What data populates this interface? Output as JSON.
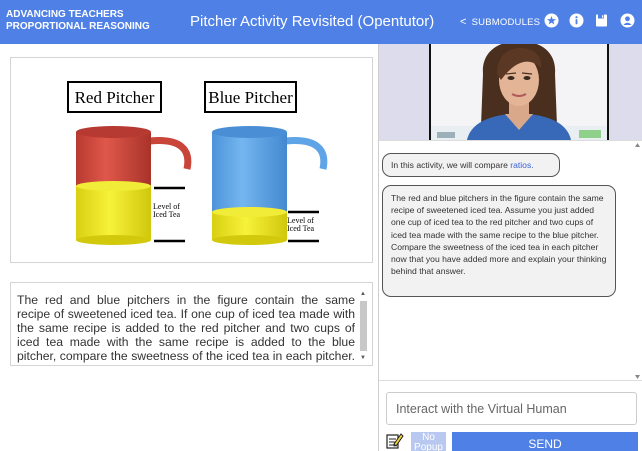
{
  "header": {
    "brand_line1": "ADVANCING TEACHERS",
    "brand_line2": "PROPORTIONAL REASONING",
    "title": "Pitcher Activity Revisited (Opentutor)",
    "submodules_label": "SUBMODULES",
    "icons": [
      "chevron-left-icon",
      "star-circle-icon",
      "info-circle-icon",
      "save-icon",
      "user-icon"
    ]
  },
  "figure": {
    "red_label": "Red Pitcher",
    "blue_label": "Blue Pitcher",
    "level_label_line1": "Level of",
    "level_label_line2": "Iced Tea",
    "colors": {
      "red": "#c9453a",
      "yellow": "#f0ea2a",
      "blue": "#5fa4e6"
    }
  },
  "question": {
    "text": "The red and blue pitchers in the figure contain the same recipe of sweetened iced tea. If one cup of iced tea made with the same recipe is added to the red pitcher and two cups of iced tea made with the same recipe is added to the blue pitcher, compare the sweetness of the iced tea in each pitcher. Explain your answer."
  },
  "chat": {
    "msg1_prefix": "In this activity, we will compare ",
    "msg1_link": "ratios.",
    "msg2": "The red and blue pitchers in the figure contain the same recipe of sweetened iced tea. Assume you just added one cup of iced tea to the red pitcher and two cups of iced tea made with the same recipe to the blue pitcher. Compare the sweetness of the iced tea in each pitcher now that you have added more and explain your thinking behind that answer."
  },
  "input": {
    "placeholder": "Interact with the Virtual Human",
    "no_popup_line1": "No",
    "no_popup_line2": "Popup",
    "send_label": "SEND"
  },
  "colors": {
    "accent": "#4f80e6",
    "link": "#3a62d8"
  }
}
